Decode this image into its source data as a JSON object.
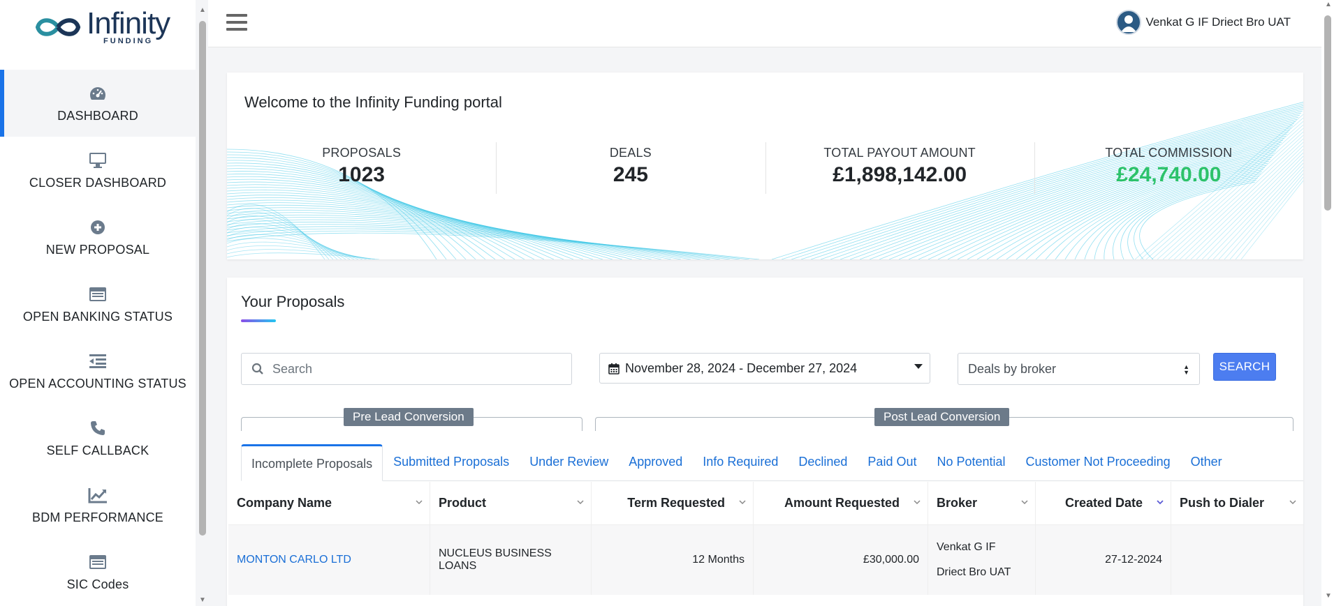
{
  "brand": {
    "name": "Infinity",
    "sub": "FUNDING"
  },
  "sidebar": {
    "items": [
      {
        "label": "DASHBOARD",
        "icon": "speedometer-icon",
        "active": true
      },
      {
        "label": "CLOSER DASHBOARD",
        "icon": "monitor-icon"
      },
      {
        "label": "NEW PROPOSAL",
        "icon": "plus-circle-icon"
      },
      {
        "label": "OPEN BANKING STATUS",
        "icon": "card-icon"
      },
      {
        "label": "OPEN ACCOUNTING STATUS",
        "icon": "indent-list-icon"
      },
      {
        "label": "SELF CALLBACK",
        "icon": "phone-icon"
      },
      {
        "label": "BDM PERFORMANCE",
        "icon": "chart-line-icon"
      },
      {
        "label": "SIC Codes",
        "icon": "card-icon"
      }
    ]
  },
  "header": {
    "user_name": "Venkat G IF Driect Bro UAT"
  },
  "welcome": {
    "title": "Welcome to the Infinity Funding portal",
    "stats": [
      {
        "label": "PROPOSALS",
        "value": "1023"
      },
      {
        "label": "DEALS",
        "value": "245"
      },
      {
        "label": "TOTAL PAYOUT AMOUNT",
        "value": "£1,898,142.00"
      },
      {
        "label": "TOTAL COMMISSION",
        "value": "£24,740.00",
        "color": "#2dc26b"
      }
    ]
  },
  "proposals": {
    "title": "Your Proposals",
    "search_placeholder": "Search",
    "date_range": "November 28, 2024 - December 27, 2024",
    "filter_selected": "Deals by broker",
    "search_button": "SEARCH",
    "groups": {
      "pre": "Pre Lead Conversion",
      "post": "Post Lead Conversion"
    },
    "tabs": [
      "Incomplete Proposals",
      "Submitted Proposals",
      "Under Review",
      "Approved",
      "Info Required",
      "Declined",
      "Paid Out",
      "No Potential",
      "Customer Not Proceeding",
      "Other"
    ],
    "active_tab": "Incomplete Proposals",
    "columns": [
      "Company Name",
      "Product",
      "Term Requested",
      "Amount Requested",
      "Broker",
      "Created Date",
      "Push to Dialer"
    ],
    "sorted_column": "Created Date",
    "rows": [
      {
        "company": "MONTON CARLO LTD",
        "product": "NUCLEUS BUSINESS LOANS",
        "term": "12 Months",
        "amount": "£30,000.00",
        "broker_line1": "Venkat G IF",
        "broker_line2": "Driect Bro UAT",
        "created": "27-12-2024",
        "push": ""
      }
    ]
  },
  "colors": {
    "accent": "#1a73e8",
    "brand": "#1c3557",
    "commission": "#2dc26b",
    "button": "#4c7df0"
  }
}
